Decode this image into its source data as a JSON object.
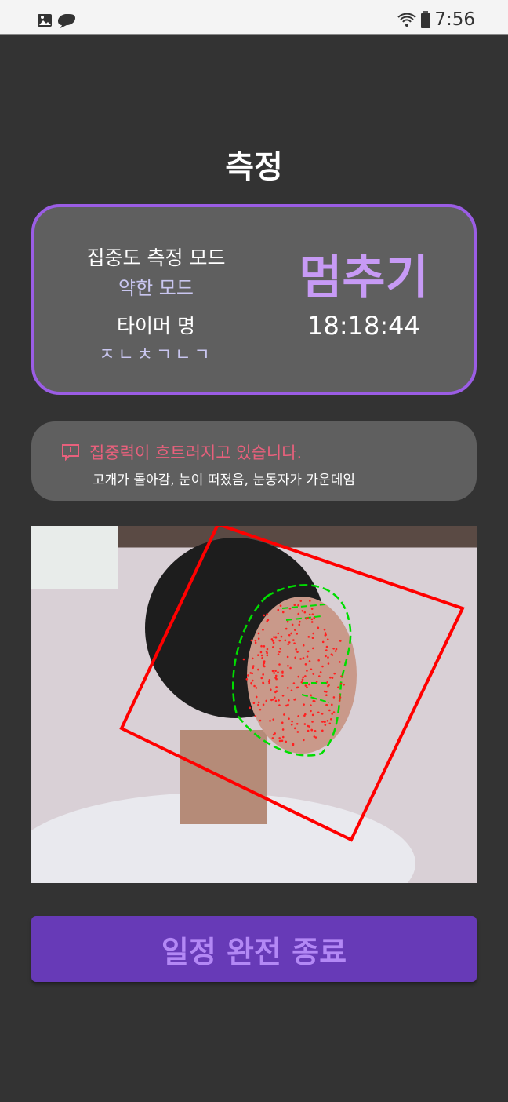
{
  "status_bar": {
    "time": "7:56",
    "left_icons": [
      "gallery-icon",
      "sync-app-icon"
    ],
    "right_icons": [
      "wifi-icon",
      "battery-icon"
    ]
  },
  "header": {
    "title": "측정"
  },
  "info_card": {
    "mode_label": "집중도 측정 모드",
    "mode_value": "약한 모드",
    "timer_label": "타이머 명",
    "timer_value": "ㅈㄴㅊㄱㄴㄱ",
    "stop_label": "멈추기",
    "elapsed": "18:18:44",
    "accent": "#9b5de5"
  },
  "alert": {
    "icon": "alert-message-icon",
    "title": "집중력이 흐트러지고 있습니다.",
    "details": "고개가 돌아감, 눈이 떠졌음, 눈동자가 가운데임",
    "color": "#e8607c"
  },
  "camera": {
    "face_box_color": "#ff0000",
    "landmark_color": "#00dd00"
  },
  "footer": {
    "end_button": "일정 완전 종료"
  }
}
